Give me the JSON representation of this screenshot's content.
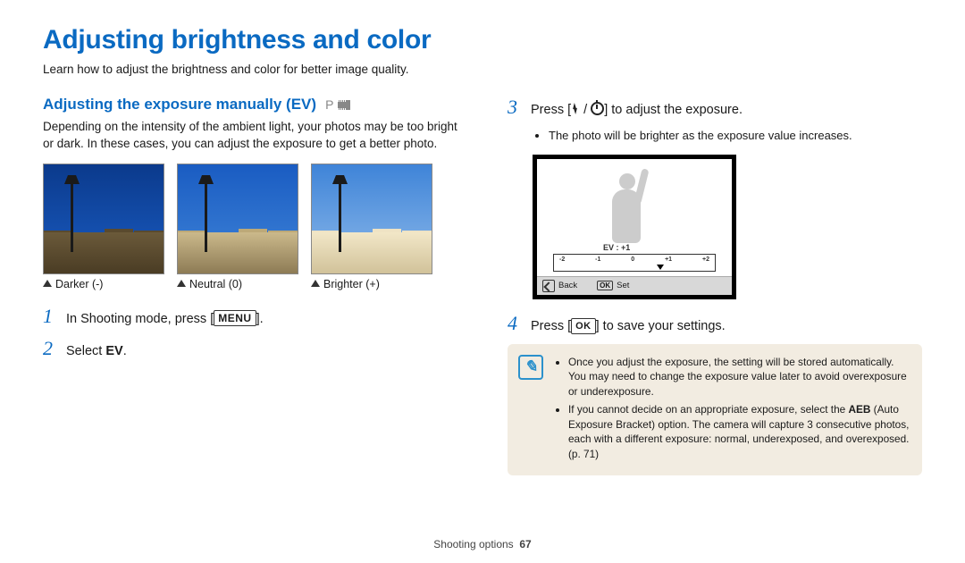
{
  "page": {
    "title": "Adjusting brightness and color",
    "intro": "Learn how to adjust the brightness and color for better image quality.",
    "footer_section": "Shooting options",
    "footer_page": "67"
  },
  "left": {
    "heading": "Adjusting the exposure manually (EV)",
    "mode_p": "P",
    "body": "Depending on the intensity of the ambient light, your photos may be too bright or dark. In these cases, you can adjust the exposure to get a better photo.",
    "captions": {
      "darker": "Darker (-)",
      "neutral": "Neutral (0)",
      "brighter": "Brighter (+)"
    },
    "step1_a": "In Shooting mode, press [",
    "step1_menu": "MENU",
    "step1_b": "].",
    "step2_a": "Select ",
    "step2_ev": "EV",
    "step2_b": "."
  },
  "right": {
    "step3_a": "Press [",
    "step3_b": " / ",
    "step3_c": "] to adjust the exposure.",
    "step3_bullet": "The photo will be brighter as the exposure value increases.",
    "lcd": {
      "ev_label": "EV : +1",
      "ticks": [
        "-2",
        "-1",
        "0",
        "+1",
        "+2"
      ],
      "back": "Back",
      "ok": "OK",
      "set": "Set"
    },
    "step4_a": "Press [",
    "step4_ok": "OK",
    "step4_b": "] to save your settings.",
    "note1": "Once you adjust the exposure, the setting will be stored automatically. You may need to change the exposure value later to avoid overexposure or underexposure.",
    "note2_a": "If you cannot decide on an appropriate exposure, select the ",
    "note2_aeb": "AEB",
    "note2_b": " (Auto Exposure Bracket) option. The camera will capture 3 consecutive photos, each with a different exposure: normal, underexposed, and overexposed. (p. 71)"
  }
}
